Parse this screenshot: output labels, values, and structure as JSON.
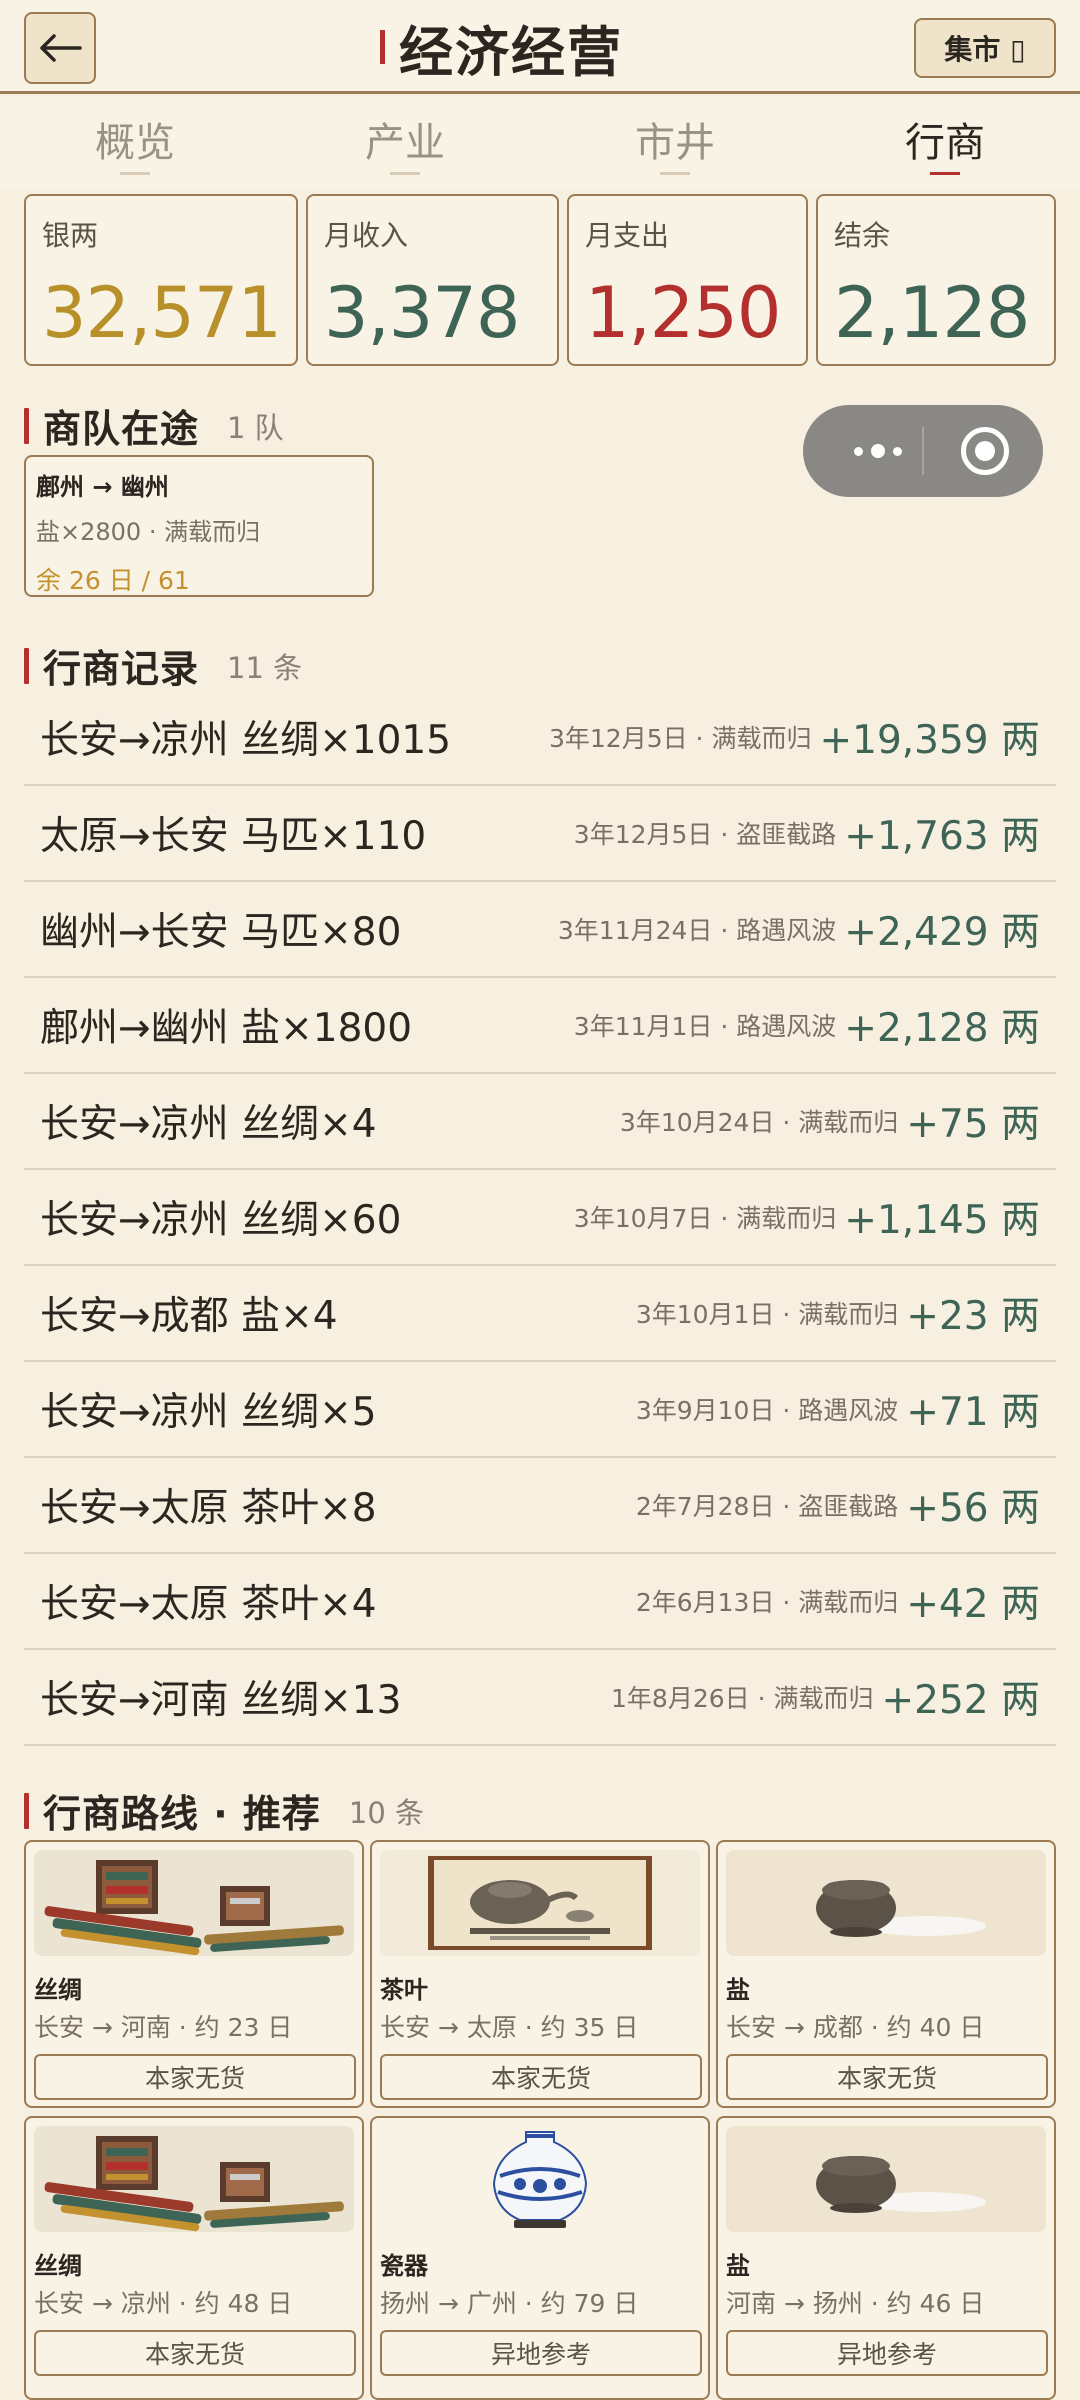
{
  "header": {
    "title": "经济经营",
    "market_label": "集市 ▯"
  },
  "tabs": [
    {
      "label": "概览",
      "active": false
    },
    {
      "label": "产业",
      "active": false
    },
    {
      "label": "市井",
      "active": false
    },
    {
      "label": "行商",
      "active": true
    }
  ],
  "stats": [
    {
      "label": "银两",
      "value": "32,571",
      "color": "#b8902a"
    },
    {
      "label": "月收入",
      "value": "3,378",
      "color": "#3d6455"
    },
    {
      "label": "月支出",
      "value": "1,250",
      "color": "#b3302e"
    },
    {
      "label": "结余",
      "value": "2,128",
      "color": "#3d6455"
    }
  ],
  "caravans": {
    "title": "商队在途",
    "count": "1 队",
    "items": [
      {
        "route": "鄜州 → 幽州",
        "cargo": "盐×2800 · 满载而归",
        "remaining": "余 26 日 / 61"
      }
    ]
  },
  "records": {
    "title": "行商记录",
    "count": "11 条",
    "items": [
      {
        "title": "长安→凉州 丝绸×1015",
        "meta": "3年12月5日 · 满载而归",
        "amount": "+19,359 两"
      },
      {
        "title": "太原→长安 马匹×110",
        "meta": "3年12月5日 · 盗匪截路",
        "amount": "+1,763 两"
      },
      {
        "title": "幽州→长安 马匹×80",
        "meta": "3年11月24日 · 路遇风波",
        "amount": "+2,429 两"
      },
      {
        "title": "鄜州→幽州 盐×1800",
        "meta": "3年11月1日 · 路遇风波",
        "amount": "+2,128 两"
      },
      {
        "title": "长安→凉州 丝绸×4",
        "meta": "3年10月24日 · 满载而归",
        "amount": "+75 两"
      },
      {
        "title": "长安→凉州 丝绸×60",
        "meta": "3年10月7日 · 满载而归",
        "amount": "+1,145 两"
      },
      {
        "title": "长安→成都 盐×4",
        "meta": "3年10月1日 · 满载而归",
        "amount": "+23 两"
      },
      {
        "title": "长安→凉州 丝绸×5",
        "meta": "3年9月10日 · 路遇风波",
        "amount": "+71 两"
      },
      {
        "title": "长安→太原 茶叶×8",
        "meta": "2年7月28日 · 盗匪截路",
        "amount": "+56 两"
      },
      {
        "title": "长安→太原 茶叶×4",
        "meta": "2年6月13日 · 满载而归",
        "amount": "+42 两"
      },
      {
        "title": "长安→河南 丝绸×13",
        "meta": "1年8月26日 · 满载而归",
        "amount": "+252 两"
      }
    ]
  },
  "routes": {
    "title": "行商路线 · 推荐",
    "count": "10 条",
    "items": [
      {
        "goods": "丝绸",
        "path": "长安 → 河南 · 约 23 日",
        "action": "本家无货",
        "image": "silk-image"
      },
      {
        "goods": "茶叶",
        "path": "长安 → 太原 · 约 35 日",
        "action": "本家无货",
        "image": "tea-image"
      },
      {
        "goods": "盐",
        "path": "长安 → 成都 · 约 40 日",
        "action": "本家无货",
        "image": "salt-image"
      },
      {
        "goods": "丝绸",
        "path": "长安 → 凉州 · 约 48 日",
        "action": "本家无货",
        "image": "silk-image"
      },
      {
        "goods": "瓷器",
        "path": "扬州 → 广州 · 约 79 日",
        "action": "异地参考",
        "image": "porcelain-image"
      },
      {
        "goods": "盐",
        "path": "河南 → 扬州 · 约 46 日",
        "action": "异地参考",
        "image": "salt-image"
      }
    ]
  }
}
